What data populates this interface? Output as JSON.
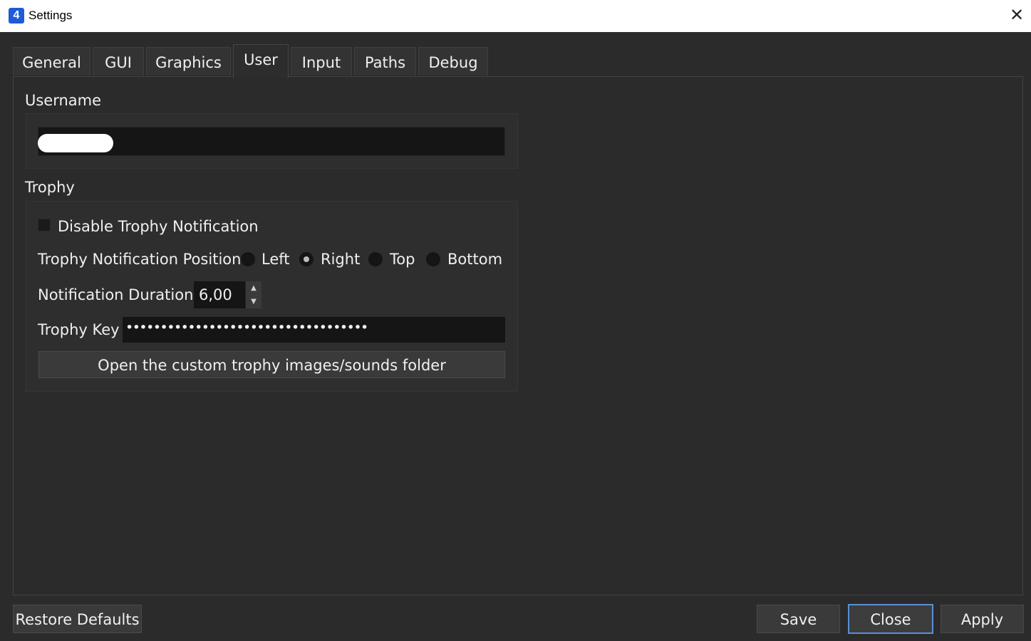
{
  "window": {
    "title": "Settings",
    "app_icon_glyph": "4",
    "close_glyph": "✕"
  },
  "tabs": [
    {
      "label": "General"
    },
    {
      "label": "GUI"
    },
    {
      "label": "Graphics"
    },
    {
      "label": "User",
      "active": true
    },
    {
      "label": "Input"
    },
    {
      "label": "Paths"
    },
    {
      "label": "Debug"
    }
  ],
  "user": {
    "username_label": "Username",
    "username_value": ""
  },
  "trophy": {
    "group_label": "Trophy",
    "disable_notification_label": "Disable Trophy Notification",
    "disable_notification_checked": false,
    "position_label": "Trophy Notification Position",
    "positions": [
      {
        "label": "Left",
        "checked": false
      },
      {
        "label": "Right",
        "checked": true
      },
      {
        "label": "Top",
        "checked": false
      },
      {
        "label": "Bottom",
        "checked": false
      }
    ],
    "duration_label": "Notification Duration",
    "duration_value": "6,00",
    "key_label": "Trophy Key",
    "key_value": "•••••••••••••••••••••••••••••••••••",
    "open_folder_label": "Open the custom trophy images/sounds folder"
  },
  "footer": {
    "restore_defaults": "Restore Defaults",
    "save": "Save",
    "close": "Close",
    "apply": "Apply"
  },
  "colors": {
    "background": "#2b2b2b",
    "focus_border": "#5a8fd4"
  }
}
